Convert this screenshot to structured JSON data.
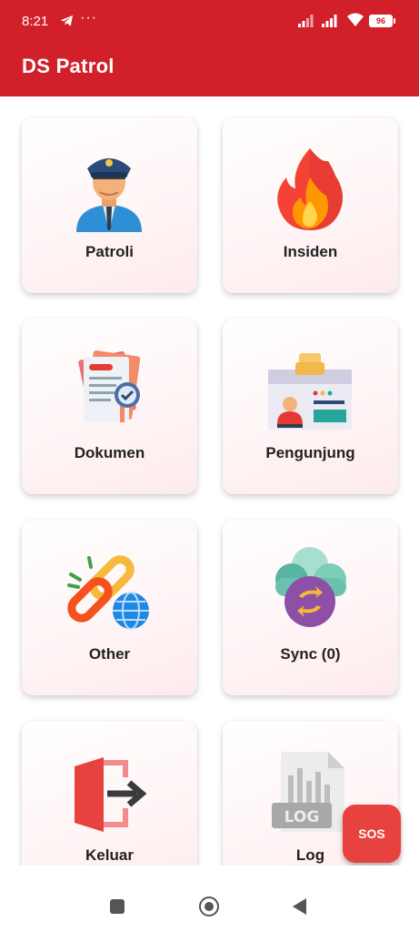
{
  "status_bar": {
    "time": "8:21",
    "overflow": "···",
    "battery": "96"
  },
  "app": {
    "title": "DS Patrol"
  },
  "menu": [
    {
      "label": "Patroli",
      "icon": "police-officer-icon"
    },
    {
      "label": "Insiden",
      "icon": "fire-icon"
    },
    {
      "label": "Dokumen",
      "icon": "document-icon"
    },
    {
      "label": "Pengunjung",
      "icon": "visitor-id-card-icon"
    },
    {
      "label": "Other",
      "icon": "link-globe-icon"
    },
    {
      "label": "Sync (0)",
      "icon": "cloud-sync-icon"
    },
    {
      "label": "Keluar",
      "icon": "exit-door-icon"
    },
    {
      "label": "Log",
      "icon": "log-file-icon"
    }
  ],
  "sos": {
    "label": "SOS"
  },
  "colors": {
    "primary": "#d2202a",
    "sos": "#e8423f"
  }
}
